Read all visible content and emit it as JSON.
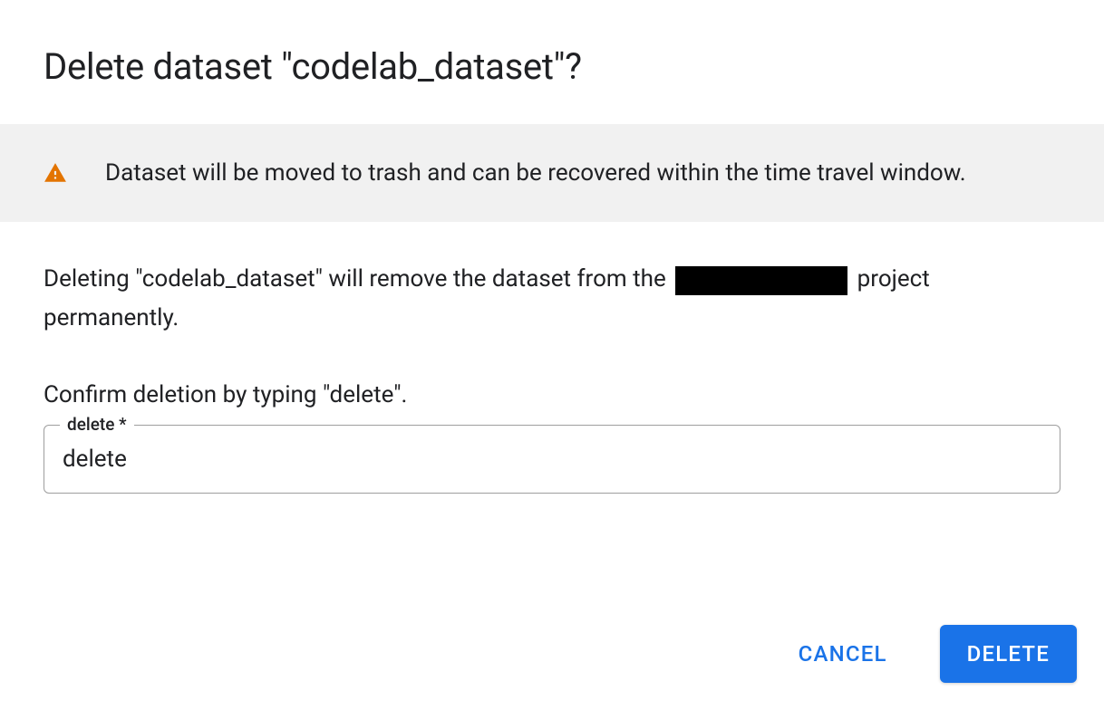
{
  "dialog": {
    "title": "Delete dataset \"codelab_dataset\"?",
    "banner": {
      "text": "Dataset will be moved to trash and can be recovered within the time travel window."
    },
    "description": {
      "prefix": "Deleting \"codelab_dataset\" will remove the dataset from the ",
      "suffix": " project permanently."
    },
    "confirm_instruction": "Confirm deletion by typing \"delete\".",
    "input": {
      "label": "delete *",
      "value": "delete"
    },
    "actions": {
      "cancel": "CANCEL",
      "delete": "DELETE"
    }
  }
}
